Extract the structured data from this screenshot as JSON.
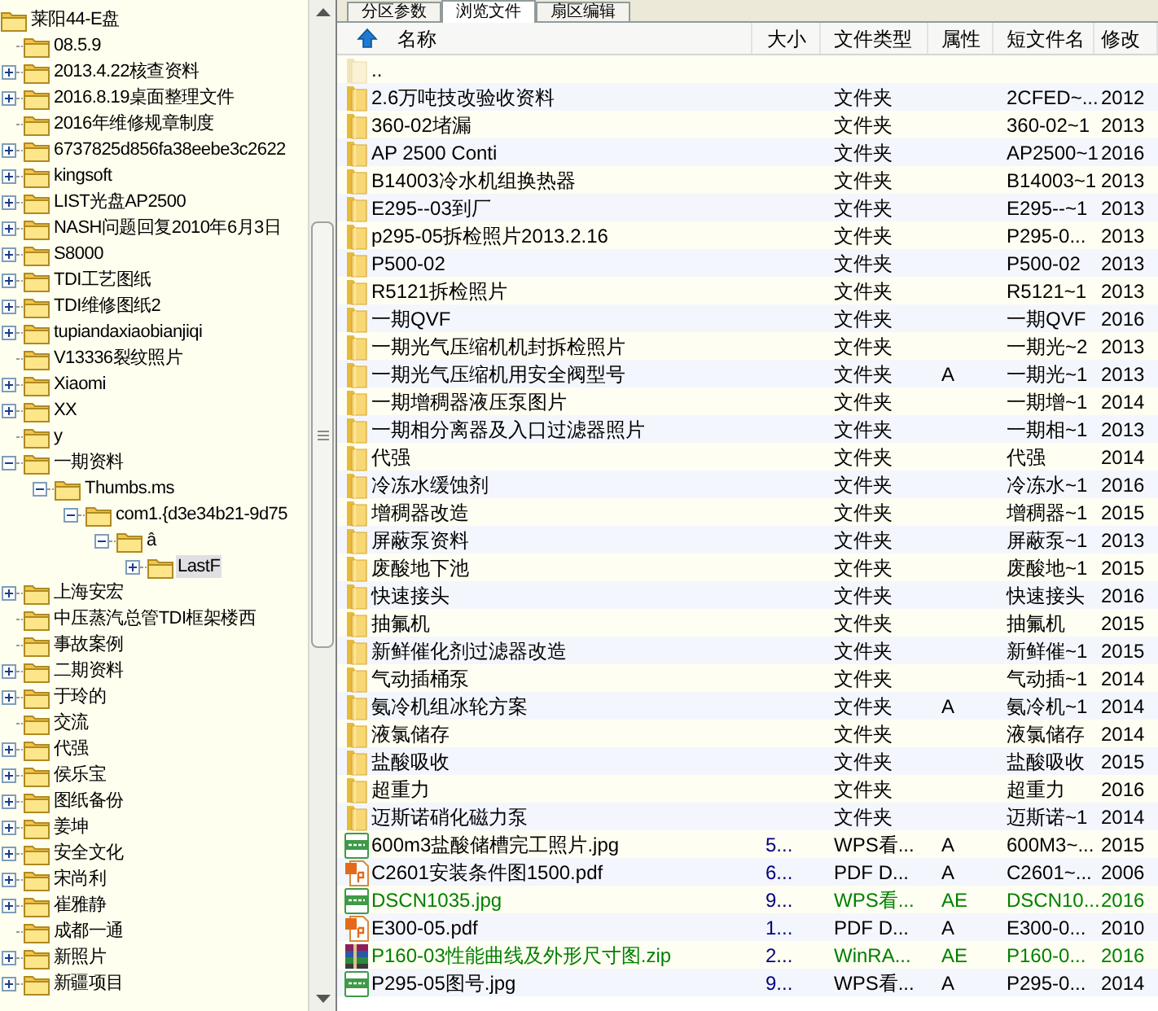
{
  "tree": {
    "label": "莱阳44-E盘",
    "kind": "root",
    "selected": false,
    "children": [
      {
        "label": "08.5.9",
        "kind": "leaf",
        "selected": false
      },
      {
        "label": "2013.4.22核查资料",
        "kind": "collapsed",
        "selected": false
      },
      {
        "label": "2016.8.19桌面整理文件",
        "kind": "collapsed",
        "selected": false
      },
      {
        "label": "2016年维修规章制度",
        "kind": "leaf",
        "selected": false
      },
      {
        "label": "6737825d856fa38eebe3c2622",
        "kind": "collapsed",
        "selected": false
      },
      {
        "label": "kingsoft",
        "kind": "collapsed",
        "selected": false
      },
      {
        "label": "LIST光盘AP2500",
        "kind": "collapsed",
        "selected": false
      },
      {
        "label": "NASH问题回复2010年6月3日",
        "kind": "collapsed",
        "selected": false
      },
      {
        "label": "S8000",
        "kind": "collapsed",
        "selected": false
      },
      {
        "label": "TDI工艺图纸",
        "kind": "collapsed",
        "selected": false
      },
      {
        "label": "TDI维修图纸2",
        "kind": "collapsed",
        "selected": false
      },
      {
        "label": "tupiandaxiaobianjiqi",
        "kind": "collapsed",
        "selected": false
      },
      {
        "label": "V13336裂纹照片",
        "kind": "leaf",
        "selected": false
      },
      {
        "label": "Xiaomi",
        "kind": "collapsed",
        "selected": false
      },
      {
        "label": "XX",
        "kind": "collapsed",
        "selected": false
      },
      {
        "label": "y",
        "kind": "leaf",
        "selected": false
      },
      {
        "label": "一期资料",
        "kind": "expanded",
        "selected": false,
        "children": [
          {
            "label": "Thumbs.ms",
            "kind": "expanded",
            "selected": false,
            "children": [
              {
                "label": "com1.{d3e34b21-9d75",
                "kind": "expanded",
                "selected": false,
                "children": [
                  {
                    "label": "â",
                    "kind": "expanded",
                    "selected": false,
                    "children": [
                      {
                        "label": "LastF",
                        "kind": "collapsed",
                        "selected": true
                      }
                    ]
                  }
                ]
              }
            ]
          }
        ]
      },
      {
        "label": "上海安宏",
        "kind": "collapsed",
        "selected": false
      },
      {
        "label": "中压蒸汽总管TDI框架楼西",
        "kind": "leaf",
        "selected": false
      },
      {
        "label": "事故案例",
        "kind": "leaf",
        "selected": false
      },
      {
        "label": "二期资料",
        "kind": "collapsed",
        "selected": false
      },
      {
        "label": "于玲的",
        "kind": "collapsed",
        "selected": false
      },
      {
        "label": "交流",
        "kind": "leaf",
        "selected": false
      },
      {
        "label": "代强",
        "kind": "collapsed",
        "selected": false
      },
      {
        "label": "侯乐宝",
        "kind": "collapsed",
        "selected": false
      },
      {
        "label": "图纸备份",
        "kind": "collapsed",
        "selected": false
      },
      {
        "label": "姜坤",
        "kind": "collapsed",
        "selected": false
      },
      {
        "label": "安全文化",
        "kind": "collapsed",
        "selected": false
      },
      {
        "label": "宋尚利",
        "kind": "collapsed",
        "selected": false
      },
      {
        "label": "崔雅静",
        "kind": "collapsed",
        "selected": false
      },
      {
        "label": "成都一通",
        "kind": "leaf",
        "selected": false
      },
      {
        "label": "新照片",
        "kind": "collapsed",
        "selected": false
      },
      {
        "label": "新疆项目",
        "kind": "collapsed",
        "selected": false
      }
    ]
  },
  "tabs": [
    {
      "label": "分区参数",
      "selected": false
    },
    {
      "label": "浏览文件",
      "selected": true
    },
    {
      "label": "扇区编辑",
      "selected": false
    }
  ],
  "table": {
    "columns": [
      "名称",
      "大小",
      "文件类型",
      "属性",
      "短文件名",
      "修改"
    ],
    "rows": [
      {
        "kind": "parent",
        "name": "..",
        "color": "#000000"
      },
      {
        "kind": "folder",
        "name": "2.6万吨技改验收资料",
        "type": "文件夹",
        "short": "2CFED~...",
        "modified": "2012",
        "color": "#000000"
      },
      {
        "kind": "folder",
        "name": "360-02堵漏",
        "type": "文件夹",
        "short": "360-02~1",
        "modified": "2013",
        "color": "#000000"
      },
      {
        "kind": "folder",
        "name": "AP 2500 Conti",
        "type": "文件夹",
        "short": "AP2500~1",
        "modified": "2016",
        "color": "#000000"
      },
      {
        "kind": "folder",
        "name": "B14003冷水机组换热器",
        "type": "文件夹",
        "short": "B14003~1",
        "modified": "2013",
        "color": "#000000"
      },
      {
        "kind": "folder",
        "name": "E295--03到厂",
        "type": "文件夹",
        "short": "E295--~1",
        "modified": "2013",
        "color": "#000000"
      },
      {
        "kind": "folder",
        "name": "p295-05拆检照片2013.2.16",
        "type": "文件夹",
        "short": "P295-0...",
        "modified": "2013",
        "color": "#000000"
      },
      {
        "kind": "folder",
        "name": "P500-02",
        "type": "文件夹",
        "short": "P500-02",
        "modified": "2013",
        "color": "#000000"
      },
      {
        "kind": "folder",
        "name": "R5121拆检照片",
        "type": "文件夹",
        "short": "R5121~1",
        "modified": "2013",
        "color": "#000000"
      },
      {
        "kind": "folder",
        "name": "一期QVF",
        "type": "文件夹",
        "short": "一期QVF",
        "modified": "2016",
        "color": "#000000"
      },
      {
        "kind": "folder",
        "name": "一期光气压缩机机封拆检照片",
        "type": "文件夹",
        "short": "一期光~2",
        "modified": "2013",
        "color": "#000000"
      },
      {
        "kind": "folder",
        "name": "一期光气压缩机用安全阀型号",
        "type": "文件夹",
        "attr": "A",
        "short": "一期光~1",
        "modified": "2013",
        "color": "#000000"
      },
      {
        "kind": "folder",
        "name": "一期增稠器液压泵图片",
        "type": "文件夹",
        "short": "一期增~1",
        "modified": "2014",
        "color": "#000000"
      },
      {
        "kind": "folder",
        "name": "一期相分离器及入口过滤器照片",
        "type": "文件夹",
        "short": "一期相~1",
        "modified": "2013",
        "color": "#000000"
      },
      {
        "kind": "folder",
        "name": "代强",
        "type": "文件夹",
        "short": "代强",
        "modified": "2014",
        "color": "#000000"
      },
      {
        "kind": "folder",
        "name": "冷冻水缓蚀剂",
        "type": "文件夹",
        "short": "冷冻水~1",
        "modified": "2016",
        "color": "#000000"
      },
      {
        "kind": "folder",
        "name": "增稠器改造",
        "type": "文件夹",
        "short": "增稠器~1",
        "modified": "2015",
        "color": "#000000"
      },
      {
        "kind": "folder",
        "name": "屏蔽泵资料",
        "type": "文件夹",
        "short": "屏蔽泵~1",
        "modified": "2013",
        "color": "#000000"
      },
      {
        "kind": "folder",
        "name": "废酸地下池",
        "type": "文件夹",
        "short": "废酸地~1",
        "modified": "2015",
        "color": "#000000"
      },
      {
        "kind": "folder",
        "name": "快速接头",
        "type": "文件夹",
        "short": "快速接头",
        "modified": "2016",
        "color": "#000000"
      },
      {
        "kind": "folder",
        "name": "抽氟机",
        "type": "文件夹",
        "short": "抽氟机",
        "modified": "2015",
        "color": "#000000"
      },
      {
        "kind": "folder",
        "name": "新鲜催化剂过滤器改造",
        "type": "文件夹",
        "short": "新鲜催~1",
        "modified": "2015",
        "color": "#000000"
      },
      {
        "kind": "folder",
        "name": "气动插桶泵",
        "type": "文件夹",
        "short": "气动插~1",
        "modified": "2014",
        "color": "#000000"
      },
      {
        "kind": "folder",
        "name": "氨冷机组冰轮方案",
        "type": "文件夹",
        "attr": "A",
        "short": "氨冷机~1",
        "modified": "2014",
        "color": "#000000"
      },
      {
        "kind": "folder",
        "name": "液氯储存",
        "type": "文件夹",
        "short": "液氯储存",
        "modified": "2014",
        "color": "#000000"
      },
      {
        "kind": "folder",
        "name": "盐酸吸收",
        "type": "文件夹",
        "short": "盐酸吸收",
        "modified": "2015",
        "color": "#000000"
      },
      {
        "kind": "folder",
        "name": "超重力",
        "type": "文件夹",
        "short": "超重力",
        "modified": "2016",
        "color": "#000000"
      },
      {
        "kind": "folder",
        "name": "迈斯诺硝化磁力泵",
        "type": "文件夹",
        "short": "迈斯诺~1",
        "modified": "2014",
        "color": "#000000"
      },
      {
        "kind": "jpg",
        "name": "600m3盐酸储槽完工照片.jpg",
        "size": "5...",
        "type": "WPS看...",
        "attr": "A",
        "short": "600M3~...",
        "modified": "2015",
        "color": "#000000"
      },
      {
        "kind": "pdf",
        "name": "C2601安装条件图1500.pdf",
        "size": "6...",
        "type": "PDF D...",
        "attr": "A",
        "short": "C2601~...",
        "modified": "2006",
        "color": "#000000"
      },
      {
        "kind": "jpg",
        "name": "DSCN1035.jpg",
        "size": "9...",
        "type": "WPS看...",
        "attr": "AE",
        "short": "DSCN10...",
        "modified": "2016",
        "color": "#008000"
      },
      {
        "kind": "pdf",
        "name": "E300-05.pdf",
        "size": "1...",
        "type": "PDF D...",
        "attr": "A",
        "short": "E300-0...",
        "modified": "2010",
        "color": "#000000"
      },
      {
        "kind": "zip",
        "name": "P160-03性能曲线及外形尺寸图.zip",
        "size": "2...",
        "type": "WinRA...",
        "attr": "AE",
        "short": "P160-0...",
        "modified": "2016",
        "color": "#008000"
      },
      {
        "kind": "jpg",
        "name": "P295-05图号.jpg",
        "size": "9...",
        "type": "WPS看...",
        "attr": "A",
        "short": "P295-0...",
        "modified": "2014",
        "color": "#000000"
      }
    ]
  }
}
